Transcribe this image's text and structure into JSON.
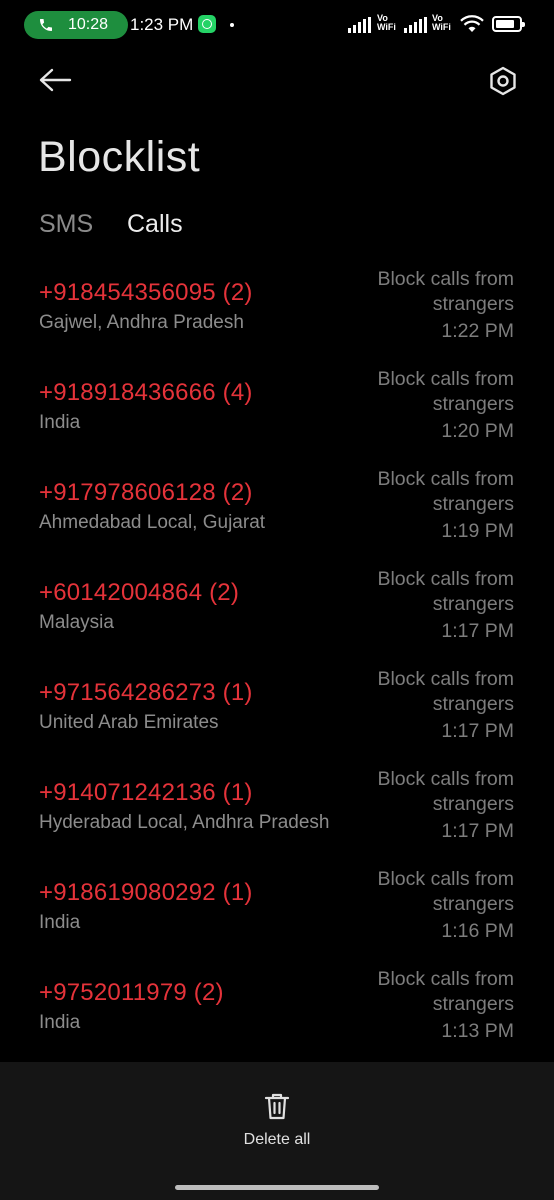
{
  "status_bar": {
    "call_time": "10:28",
    "clock": "1:23 PM",
    "vowifi_label_1": "Vo",
    "vowifi_label_2": "WiFi"
  },
  "header": {
    "title": "Blocklist"
  },
  "tabs": [
    {
      "label": "SMS",
      "active": false
    },
    {
      "label": "Calls",
      "active": true
    }
  ],
  "blocked_calls": [
    {
      "number": "+918454356095 (2)",
      "location": "Gajwel, Andhra Pradesh",
      "reason": "Block calls from strangers",
      "time": "1:22 PM"
    },
    {
      "number": "+918918436666 (4)",
      "location": "India",
      "reason": "Block calls from strangers",
      "time": "1:20 PM"
    },
    {
      "number": "+917978606128 (2)",
      "location": "Ahmedabad Local, Gujarat",
      "reason": "Block calls from strangers",
      "time": "1:19 PM"
    },
    {
      "number": "+60142004864 (2)",
      "location": "Malaysia",
      "reason": "Block calls from strangers",
      "time": "1:17 PM"
    },
    {
      "number": "+971564286273 (1)",
      "location": "United Arab Emirates",
      "reason": "Block calls from strangers",
      "time": "1:17 PM"
    },
    {
      "number": "+914071242136 (1)",
      "location": "Hyderabad Local, Andhra Pradesh",
      "reason": "Block calls from strangers",
      "time": "1:17 PM"
    },
    {
      "number": "+918619080292 (1)",
      "location": "India",
      "reason": "Block calls from strangers",
      "time": "1:16 PM"
    },
    {
      "number": "+9752011979 (2)",
      "location": "India",
      "reason": "Block calls from strangers",
      "time": "1:13 PM"
    }
  ],
  "bottom_bar": {
    "delete_all_label": "Delete all"
  },
  "colors": {
    "number_red": "#e5333a",
    "call_pill_green": "#1e8e3e"
  },
  "icons": [
    "phone-icon",
    "whatsapp-icon",
    "signal-icon",
    "wifi-icon",
    "battery-icon",
    "back-arrow-icon",
    "settings-icon",
    "trash-icon"
  ]
}
